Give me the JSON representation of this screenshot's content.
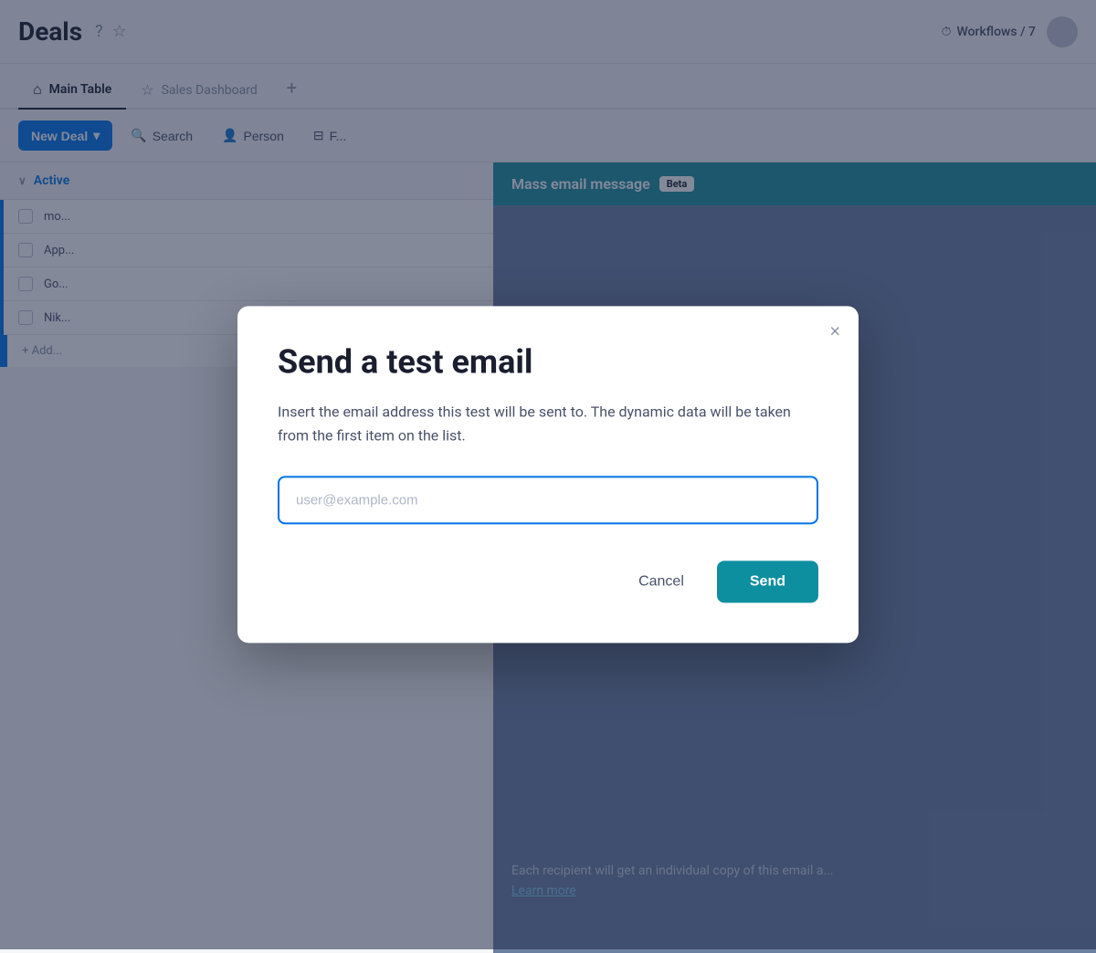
{
  "header": {
    "title": "Deals",
    "help_icon": "?",
    "star_icon": "☆",
    "workflows_label": "Workflows / 7"
  },
  "tabs": [
    {
      "id": "main-table",
      "label": "Main Table",
      "icon": "⌂",
      "active": true
    },
    {
      "id": "sales-dashboard",
      "label": "Sales Dashboard",
      "icon": "☆",
      "active": false
    }
  ],
  "toolbar": {
    "new_deal_label": "New Deal",
    "new_deal_arrow": "▾",
    "search_label": "Search",
    "person_label": "Person",
    "filter_label": "F..."
  },
  "table": {
    "group_label": "Active",
    "rows": [
      {
        "id": 1,
        "name": "mo..."
      },
      {
        "id": 2,
        "name": "App..."
      },
      {
        "id": 3,
        "name": "Go..."
      },
      {
        "id": 4,
        "name": "Nik..."
      }
    ],
    "add_row_label": "+ Add..."
  },
  "right_panel": {
    "title": "Mass email message",
    "beta_label": "Beta",
    "bottom_note": "Each recipient will get an individual copy of this email a...",
    "learn_more_label": "Learn more"
  },
  "modal": {
    "title": "Send a test email",
    "description": "Insert the email address this test will be sent to. The dynamic data will be taken from the first item on the list.",
    "input_placeholder": "user@example.com",
    "cancel_label": "Cancel",
    "send_label": "Send",
    "close_icon": "×"
  }
}
